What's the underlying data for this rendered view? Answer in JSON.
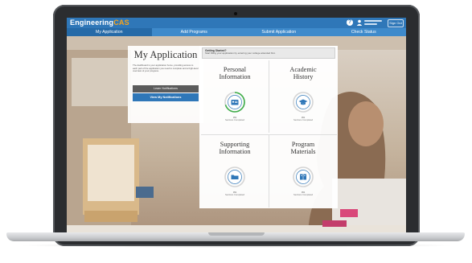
{
  "app": {
    "brand_prefix": "Engineering",
    "brand_suffix": "CAS",
    "signout_label": "Sign Out",
    "help_icon": "?",
    "user_icon": "user-icon"
  },
  "tabs": [
    {
      "label": "My Application",
      "active": true
    },
    {
      "label": "Add Programs",
      "active": false
    },
    {
      "label": "Submit Application",
      "active": false
    },
    {
      "label": "Check Status",
      "active": false
    }
  ],
  "intro": {
    "title": "My Application",
    "description": "The dashboard is your application home, providing access to each part of the application you need to complete and a high-level overview of your progress.",
    "learn_button": "Learn Notifications",
    "view_button": "View My Notifications"
  },
  "notice": {
    "title": "Getting Started?",
    "body": "Start filling your application by entering your college attended first."
  },
  "quadrants": [
    {
      "title_line1": "Personal",
      "title_line2": "Information",
      "icon": "id-card-icon",
      "percent": "0%",
      "status": "Sections Completed",
      "progress": 0.7
    },
    {
      "title_line1": "Academic",
      "title_line2": "History",
      "icon": "graduation-cap-icon",
      "percent": "0%",
      "status": "Sections Completed",
      "progress": 0
    },
    {
      "title_line1": "Supporting",
      "title_line2": "Information",
      "icon": "folder-icon",
      "percent": "0%",
      "status": "Sections Completed",
      "progress": 0
    },
    {
      "title_line1": "Program",
      "title_line2": "Materials",
      "icon": "book-icon",
      "percent": "0%",
      "status": "Sections Completed",
      "progress": 0
    }
  ],
  "colors": {
    "primary": "#2f77b8",
    "accent": "#f6a21b",
    "progress_green": "#3fae49",
    "ring_gray": "#d5d5d5"
  }
}
